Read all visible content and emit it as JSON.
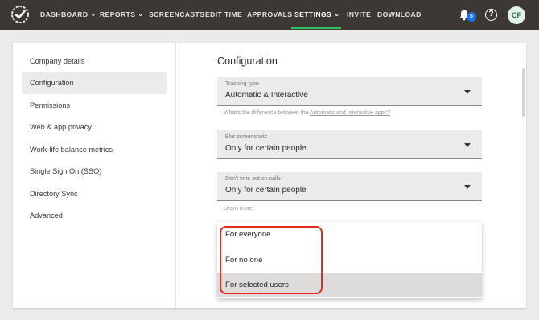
{
  "nav": {
    "items": [
      {
        "label": "DASHBOARD",
        "has_caret": true
      },
      {
        "label": "REPORTS",
        "has_caret": true
      },
      {
        "label": "SCREENCASTS",
        "has_caret": false
      },
      {
        "label": "EDIT TIME",
        "has_caret": false
      },
      {
        "label": "APPROVALS",
        "has_caret": false
      },
      {
        "label": "SETTINGS",
        "has_caret": true,
        "active": true
      },
      {
        "label": "INVITE",
        "has_caret": false
      },
      {
        "label": "DOWNLOAD",
        "has_caret": false
      }
    ],
    "caret": "⌄",
    "notification_count": "5",
    "help_glyph": "?",
    "avatar_initials": "CF",
    "accent_color": "#2dbf67"
  },
  "sidebar": {
    "items": [
      {
        "label": "Company details"
      },
      {
        "label": "Configuration",
        "active": true
      },
      {
        "label": "Permissions"
      },
      {
        "label": "Web & app privacy"
      },
      {
        "label": "Work-life balance metrics"
      },
      {
        "label": "Single Sign On (SSO)"
      },
      {
        "label": "Directory Sync"
      },
      {
        "label": "Advanced"
      }
    ]
  },
  "main": {
    "title": "Configuration",
    "tracking": {
      "label": "Tracking type",
      "value": "Automatic & Interactive",
      "hint_prefix": "What's the difference between the ",
      "hint_link": "Automatic and Interactive apps?"
    },
    "blur": {
      "label": "Blur screenshots",
      "value": "Only for certain people"
    },
    "timeout": {
      "label": "Don't time out on calls",
      "value": "Only for certain people",
      "learn_more": "Learn more"
    },
    "dropdown": {
      "options": [
        {
          "label": "For everyone"
        },
        {
          "label": "For no one"
        },
        {
          "label": "For selected users",
          "selected": true
        }
      ],
      "highlight_color": "#e8281f"
    }
  }
}
